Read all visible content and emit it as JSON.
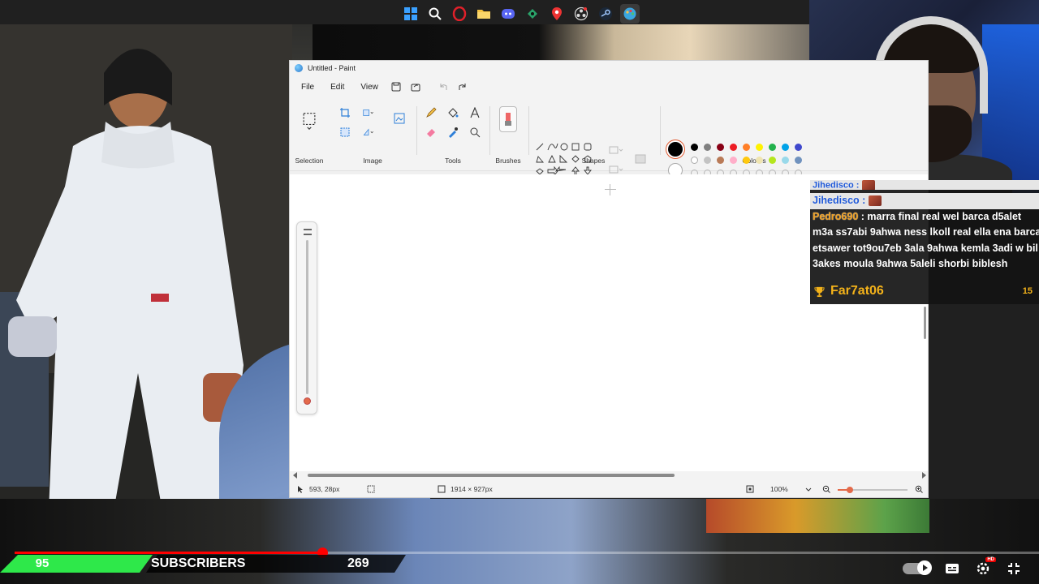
{
  "taskbar": {
    "icons": [
      "windows-start-icon",
      "search-icon",
      "opera-icon",
      "file-explorer-icon",
      "discord-icon",
      "app-icon",
      "maps-pin-icon",
      "obs-icon",
      "steam-icon",
      "paint-icon"
    ]
  },
  "paint": {
    "title": "Untitled - Paint",
    "menu": {
      "file": "File",
      "edit": "Edit",
      "view": "View"
    },
    "groups": {
      "selection": "Selection",
      "image": "Image",
      "tools": "Tools",
      "brushes": "Brushes",
      "shapes": "Shapes",
      "colours": "Colours"
    },
    "colors": {
      "primary": "#000000",
      "secondary": "#ffffff",
      "palette_row1": [
        "#000000",
        "#7f7f7f",
        "#880015",
        "#ed1c24",
        "#ff7f27",
        "#fff200",
        "#22b14c",
        "#00a2e8",
        "#3f48cc"
      ],
      "palette_row2": [
        "#ffffff",
        "#c3c3c3",
        "#b97a57",
        "#ffaec9",
        "#ffc90e",
        "#efe4b0",
        "#b5e61d",
        "#99d9ea",
        "#7092be"
      ]
    },
    "status": {
      "cursor_pos": "593, 28px",
      "canvas_size": "1914 × 927px",
      "zoom": "100%"
    }
  },
  "chat": {
    "lines": [
      {
        "user": "Jihedisco",
        "text": ""
      },
      {
        "user": "Jihedisco",
        "text": ""
      },
      {
        "user": "Pedro690",
        "text": "marra final real wel barca d5alet"
      },
      {
        "user": "",
        "text": "m3a ss7abi 9ahwa ness lkoll real ella ena barca"
      },
      {
        "user": "",
        "text": "etsawer tot9ou7eb 3ala 9ahwa kemla 3adi w bil"
      },
      {
        "user": "",
        "text": "3akes moula 9ahwa 5aleli shorbi biblesh"
      }
    ],
    "top_supporter": {
      "name": "Far7at06",
      "count": "15"
    }
  },
  "overlay": {
    "subscriber_count": "95",
    "subscriber_label": "SUBSCRIBERS",
    "subscriber_goal": "269",
    "video_progress": 0.3
  },
  "yt_controls": {
    "icons": [
      "autoplay-toggle",
      "subtitles-icon",
      "settings-icon",
      "fullscreen-exit-icon"
    ],
    "hd_label": "HD"
  }
}
